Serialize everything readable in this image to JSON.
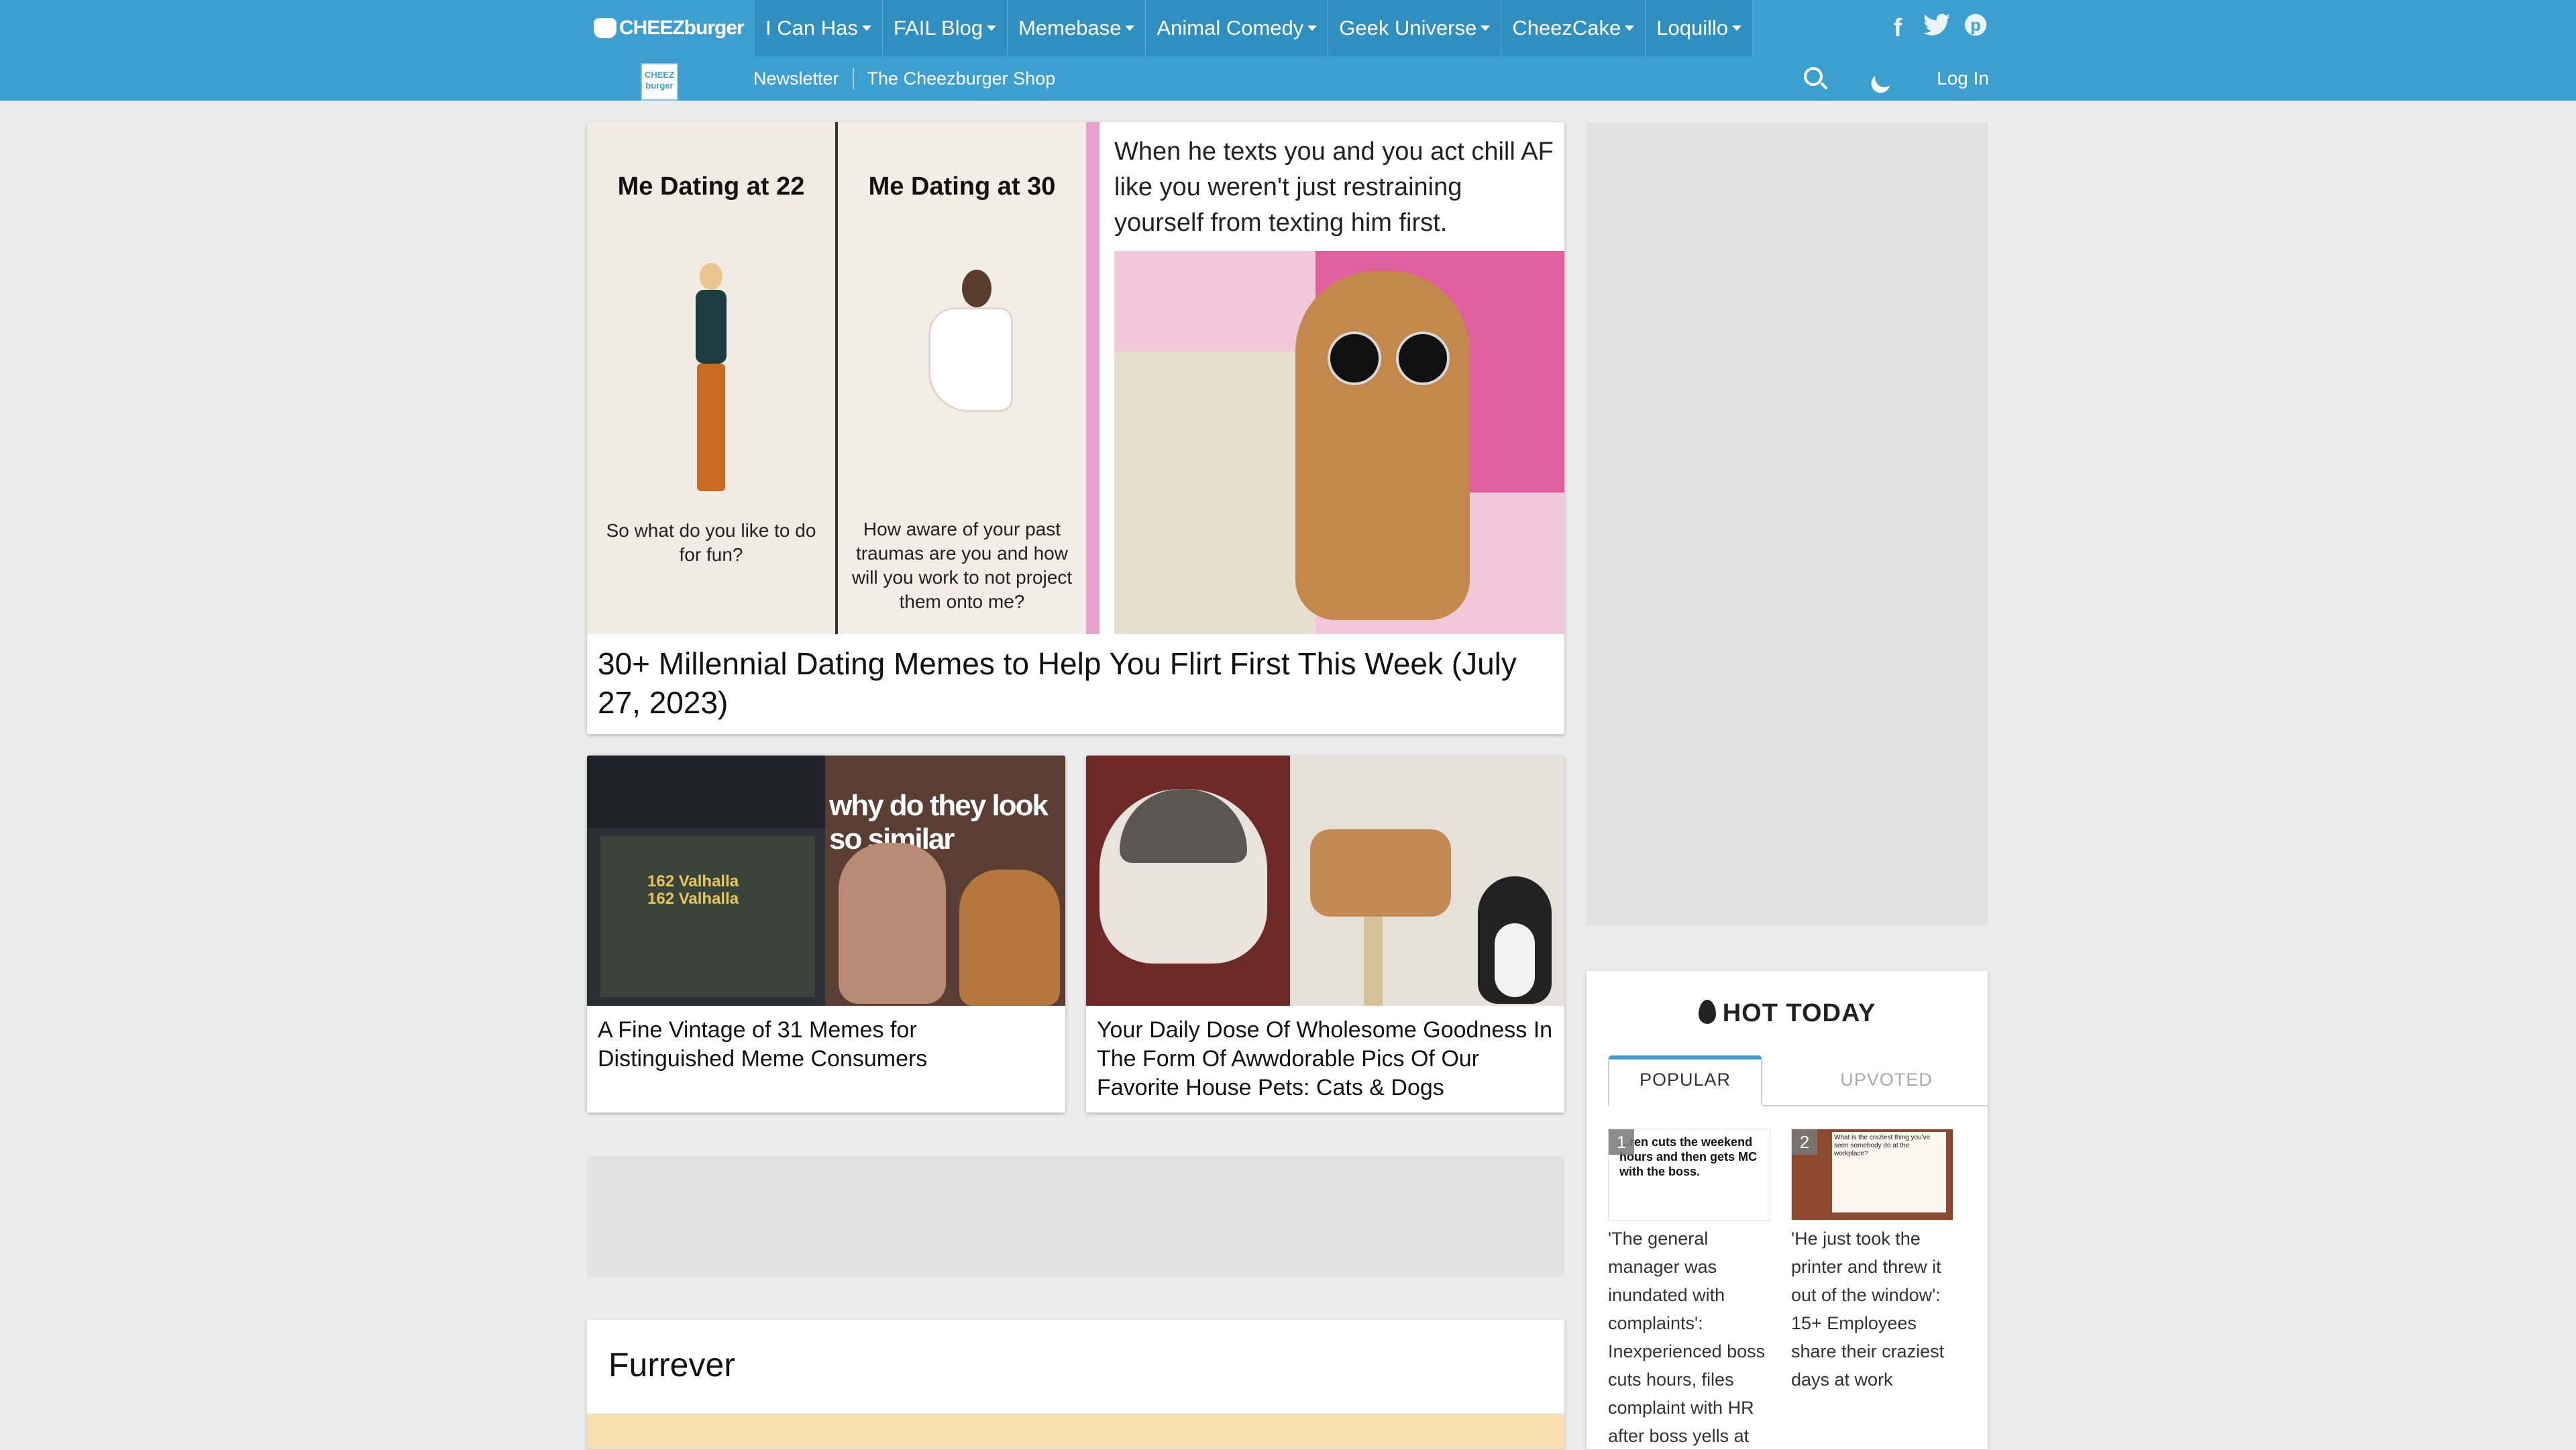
{
  "header": {
    "logo_text": "CHEEZburger",
    "menu": [
      "I Can Has",
      "FAIL Blog",
      "Memebase",
      "Animal Comedy",
      "Geek Universe",
      "CheezCake",
      "Loquillo"
    ],
    "social_icons": [
      "facebook-icon",
      "twitter-icon",
      "pinterest-icon"
    ],
    "subnav": [
      "Newsletter",
      "The Cheezburger Shop"
    ],
    "mini_logo": "CHEEZ burger",
    "login": "Log In",
    "brand_color": "#3d9fd0"
  },
  "featured": {
    "meme_left_title": "Me Dating at 22",
    "meme_left_caption": "So what do you like to do for fun?",
    "meme_right_title": "Me Dating at 30",
    "meme_right_caption": "How aware of your past traumas are you and how will you work to not project them onto me?",
    "meme2_caption": "When he texts you and you act chill AF like you weren't just restraining yourself from texting him first.",
    "title": "30+ Millennial Dating Memes to Help You Flirt First This Week (July 27, 2023)"
  },
  "cards": [
    {
      "title": "A Fine Vintage of 31 Memes for Distinguished Meme Consumers",
      "img_text_left": "162 Valhalla\n162 Valhalla",
      "img_text_right": "why do they look so similar"
    },
    {
      "title": "Your Daily Dose Of Wholesome Goodness In The Form Of Awwdorable Pics Of Our Favorite House Pets: Cats & Dogs"
    }
  ],
  "section": {
    "title": "Furrever"
  },
  "hot_today": {
    "heading": "HOT TODAY",
    "tabs": [
      "POPULAR",
      "UPVOTED"
    ],
    "items": [
      {
        "rank": "1",
        "thumb_text": "...ren cuts the weekend hours and then gets MC with the boss.",
        "caption": "'The general manager was inundated with complaints': Inexperienced boss cuts hours, files complaint with HR after boss yells at"
      },
      {
        "rank": "2",
        "thumb_text": "What is the craziest thing you've seen somebody do at the workplace?",
        "caption": "'He just took the printer and threw it out of the window': 15+ Employees share their craziest days at work"
      }
    ]
  }
}
